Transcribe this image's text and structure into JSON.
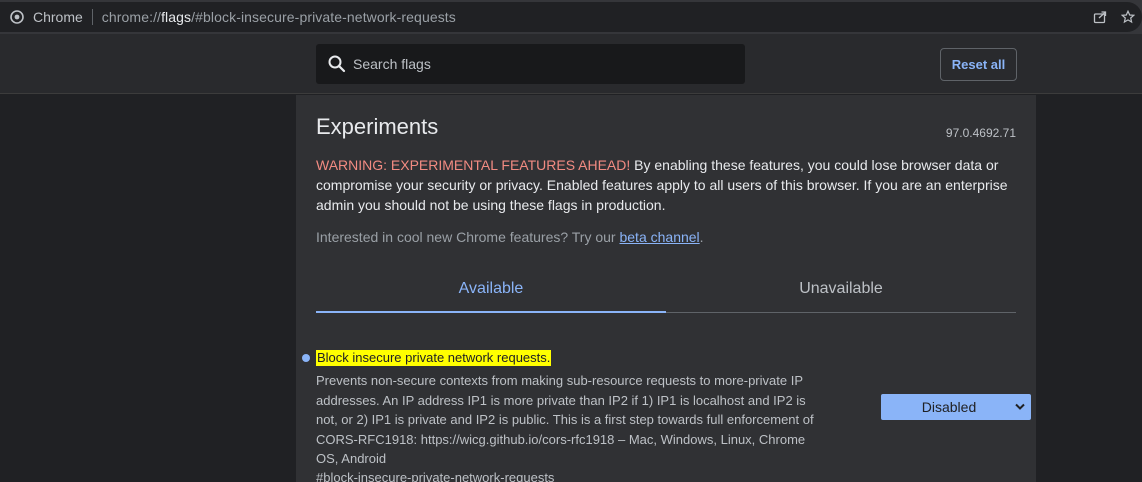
{
  "browser": {
    "site_name": "Chrome",
    "url_prefix": "chrome://",
    "url_host": "flags",
    "url_rest": "/#block-insecure-private-network-requests"
  },
  "header": {
    "search_placeholder": "Search flags",
    "reset_label": "Reset all"
  },
  "main": {
    "title": "Experiments",
    "version": "97.0.4692.71",
    "warning_head": "WARNING: EXPERIMENTAL FEATURES AHEAD!",
    "warning_body": " By enabling these features, you could lose browser data or compromise your security or privacy. Enabled features apply to all users of this browser. If you are an enterprise admin you should not be using these flags in production.",
    "interest_text": "Interested in cool new Chrome features? Try our ",
    "interest_link": "beta channel",
    "interest_end": ".",
    "tabs": [
      {
        "label": "Available",
        "active": true
      },
      {
        "label": "Unavailable",
        "active": false
      }
    ]
  },
  "flag": {
    "title": "Block insecure private network requests.",
    "description": "Prevents non-secure contexts from making sub-resource requests to more-private IP addresses. An IP address IP1 is more private than IP2 if 1) IP1 is localhost and IP2 is not, or 2) IP1 is private and IP2 is public. This is a first step towards full enforcement of CORS-RFC1918: https://wicg.github.io/cors-rfc1918 – Mac, Windows, Linux, Chrome OS, Android",
    "anchor": "#block-insecure-private-network-requests",
    "selected_value": "Disabled"
  },
  "colors": {
    "accent": "#8ab4f8",
    "warning": "#f28b82",
    "highlight": "#ffff00",
    "background": "#202124",
    "panel": "#303134"
  }
}
